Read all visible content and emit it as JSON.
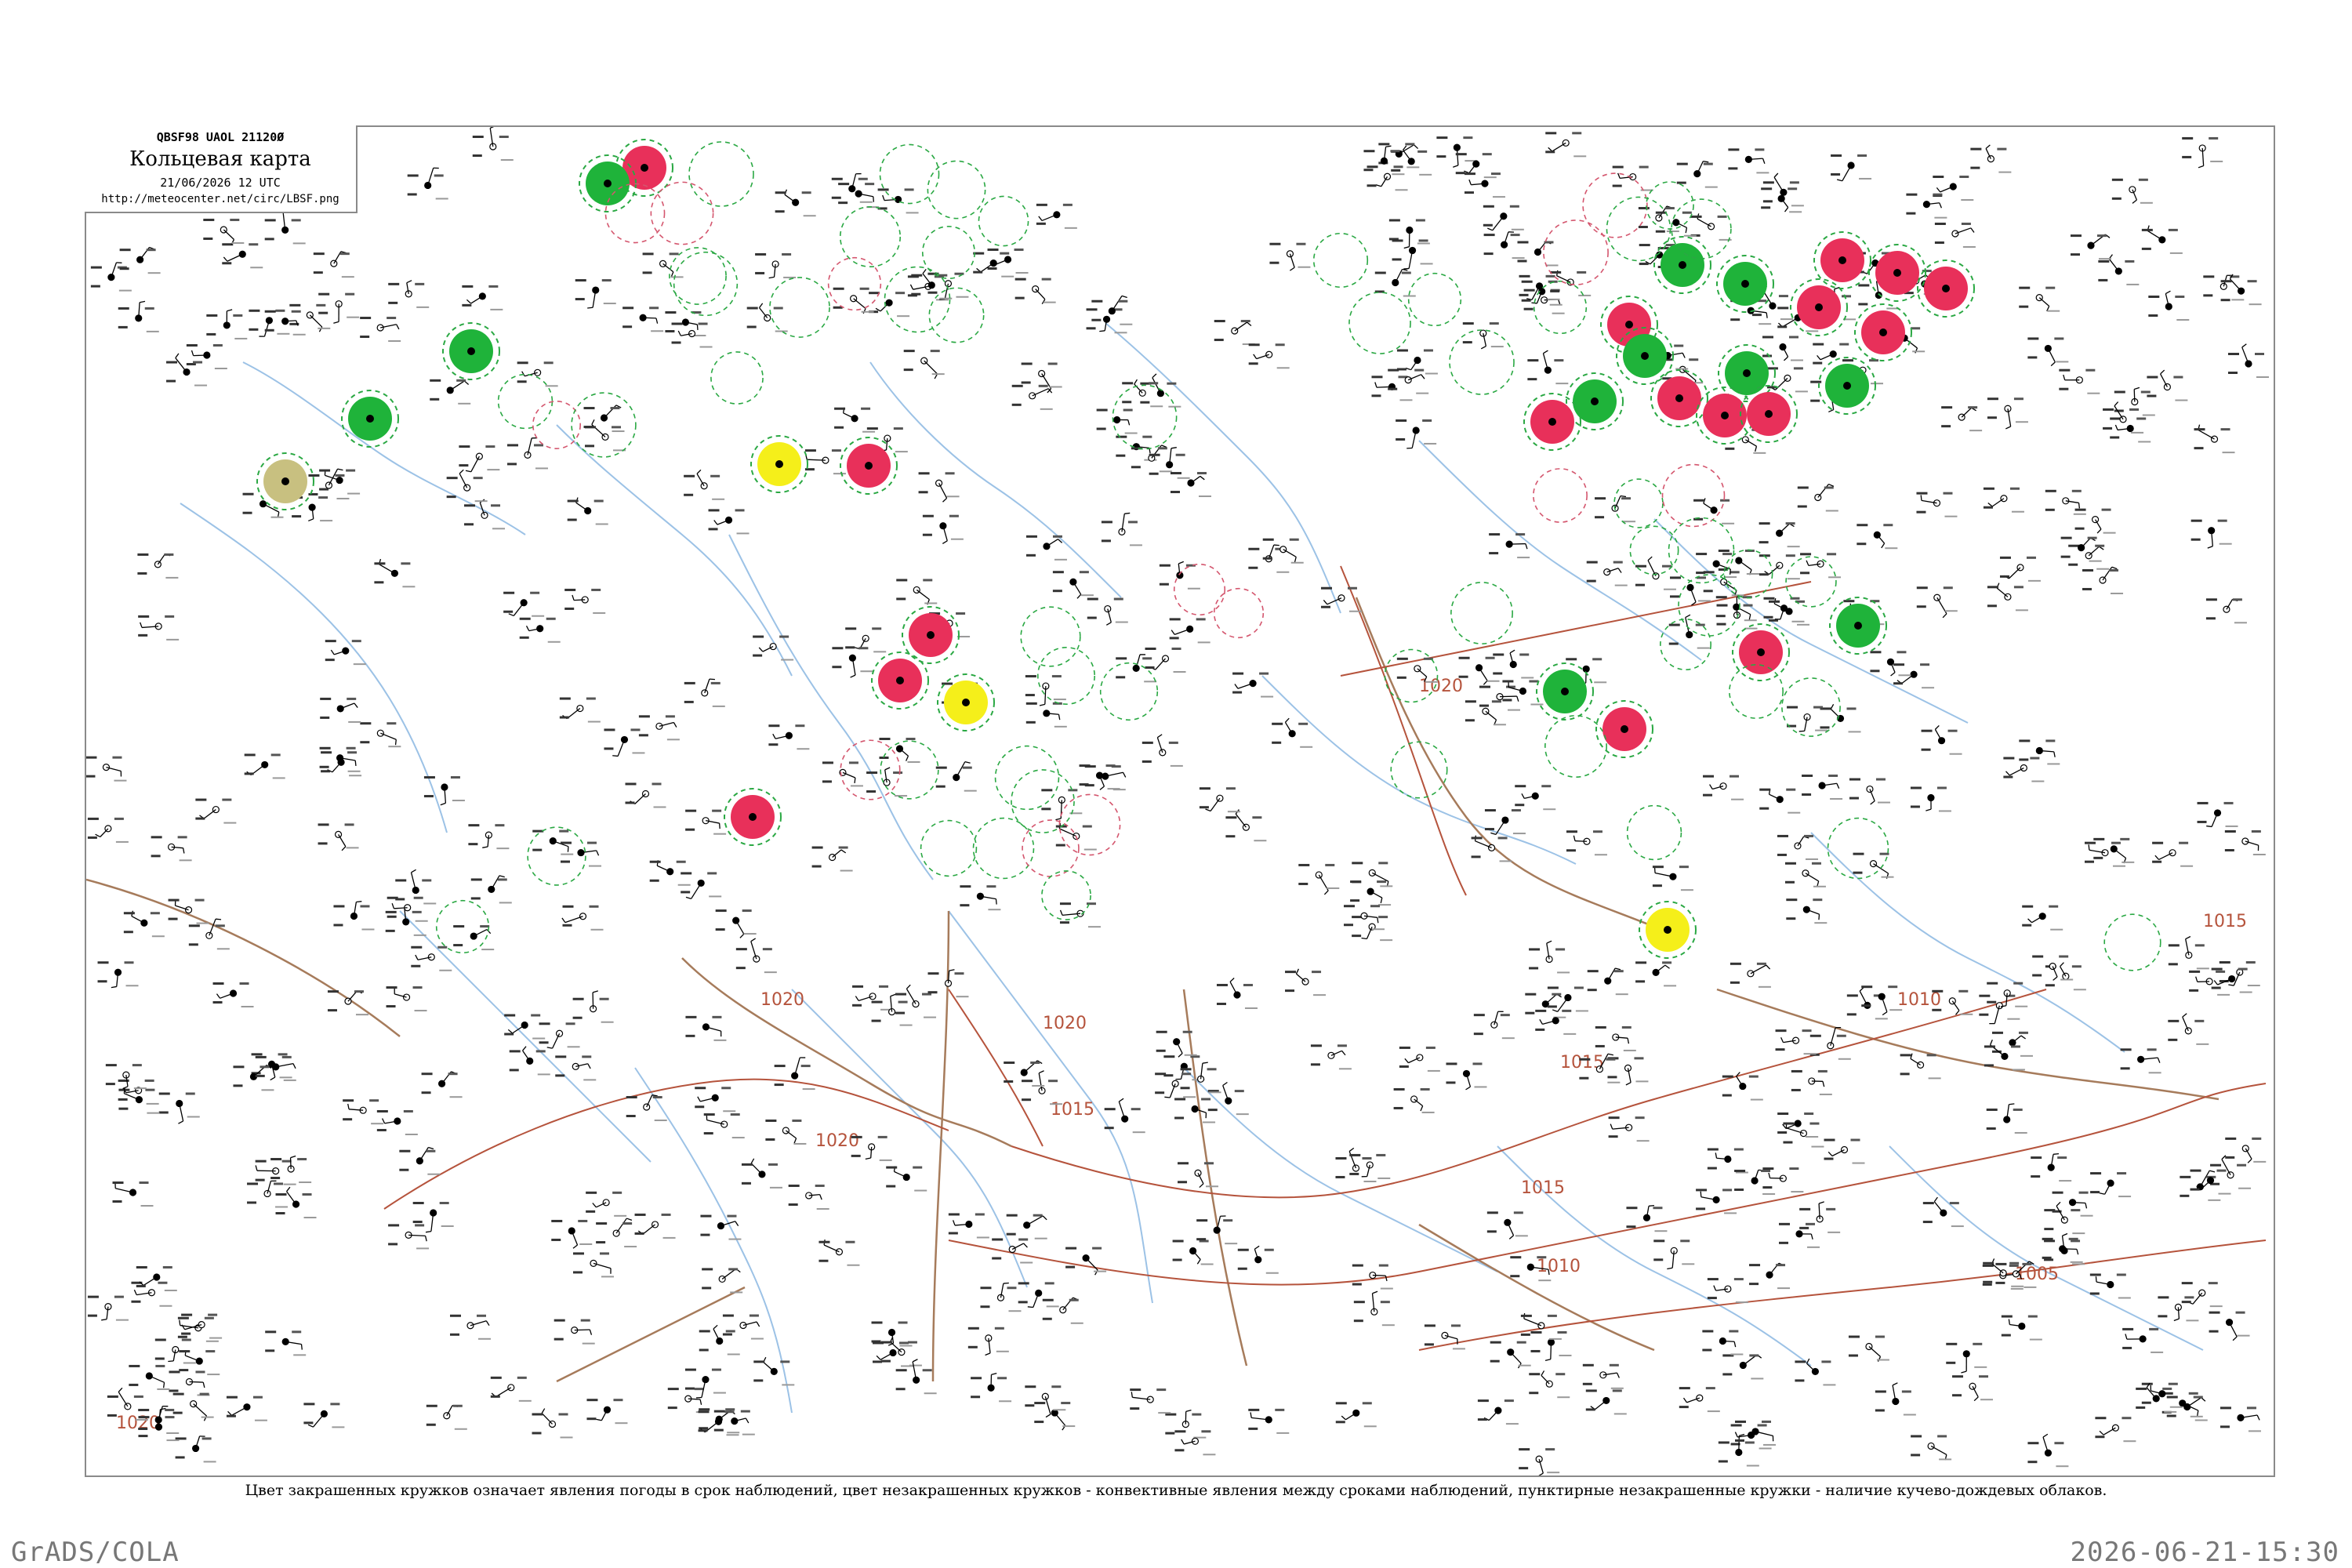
{
  "title_box": {
    "header": "QBSF98  UAOL  21120Ø",
    "title": "Кольцевая карта",
    "datetime": "21/06/2026 12 UTC",
    "url": "http://meteocenter.net/circ/LBSF.png"
  },
  "legend": "Цвет закрашенных кружков означает явления погоды в срок наблюдений, цвет незакрашенных кружков - конвективные явления между сроками наблюдений, пунктирные незакрашенные кружки - наличие кучево-дождевых облаков.",
  "footer": {
    "left": "GrADS/COLA",
    "right": "2026-06-21-15:30"
  },
  "colors": {
    "thunderstorm_fill": "#e8305a",
    "shower_fill": "#1fb33a",
    "fog_fill": "#f5ef1a",
    "haze_fill": "#c8c080",
    "isobar": "#b5533c",
    "river": "#9cc2e6",
    "cb_dashed": "#2aa843"
  },
  "isobar_labels": [
    "1020",
    "1020",
    "1020",
    "1020",
    "1015",
    "1015",
    "1015",
    "1010",
    "1010",
    "1005",
    "1020",
    "1015"
  ]
}
